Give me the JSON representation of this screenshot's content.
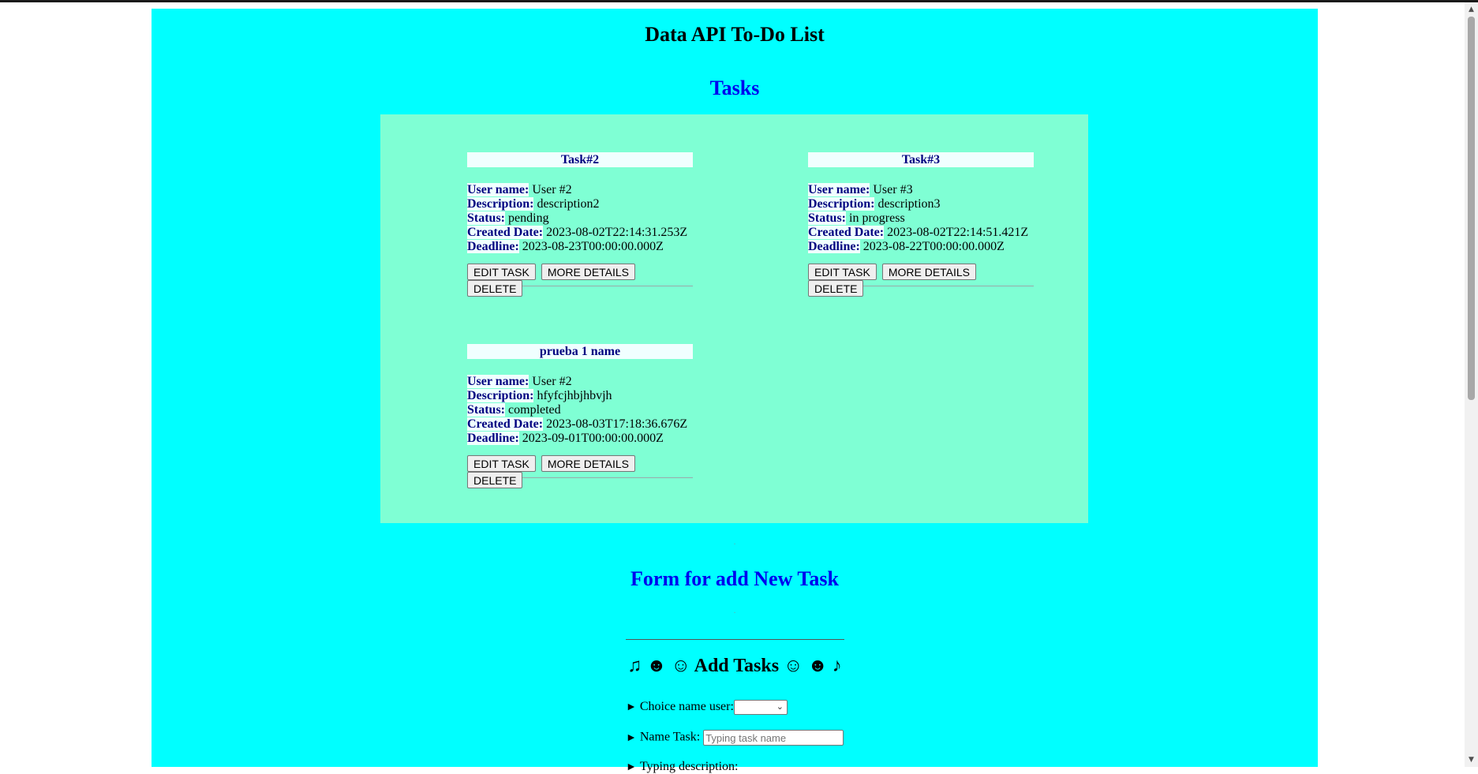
{
  "app": {
    "title": "Data API To-Do List"
  },
  "tasks_section": {
    "title": "Tasks"
  },
  "field_labels": {
    "user": "User name:",
    "description": "Description:",
    "status": "Status:",
    "created": "Created Date:",
    "deadline": "Deadline:"
  },
  "buttons": {
    "edit": "EDIT TASK",
    "details": "MORE DETAILS",
    "delete": "DELETE"
  },
  "tasks": [
    {
      "name": "Task#2",
      "user": "User #2",
      "description": "description2",
      "status": "pending",
      "created": "2023-08-02T22:14:31.253Z",
      "deadline": "2023-08-23T00:00:00.000Z"
    },
    {
      "name": "Task#3",
      "user": "User #3",
      "description": "description3",
      "status": "in progress",
      "created": "2023-08-02T22:14:51.421Z",
      "deadline": "2023-08-22T00:00:00.000Z"
    },
    {
      "name": "prueba 1 name",
      "user": "User #2",
      "description": "hfyfcjhbjhbvjh",
      "status": "completed",
      "created": "2023-08-03T17:18:36.676Z",
      "deadline": "2023-09-01T00:00:00.000Z"
    }
  ],
  "form_section": {
    "title": "Form for add New Task"
  },
  "form": {
    "heading": "♫ ☻ ☺ Add Tasks ☺ ☻ ♪",
    "arrow": "►",
    "user_label": "Choice name user:",
    "user_selected": "",
    "name_label": "Name Task:",
    "name_placeholder": "Typing task name",
    "description_label": "Typing description:"
  },
  "colors": {
    "page_bg": "#00ffff",
    "panel_bg": "#7fffd4",
    "label_bg": "#f0ffff",
    "label_text": "#000080",
    "section_title": "#0000ee"
  }
}
